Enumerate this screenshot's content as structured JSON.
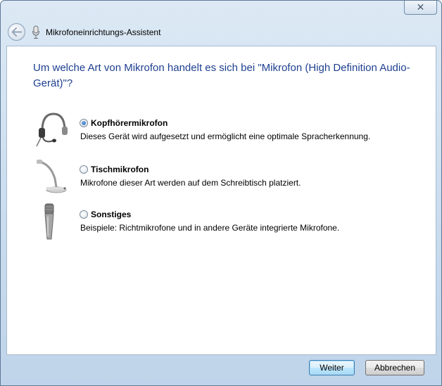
{
  "window": {
    "title": "Mikrofoneinrichtungs-Assistent",
    "close_glyph": "✕"
  },
  "main": {
    "question": "Um welche Art von Mikrofon handelt es sich bei \"Mikrofon (High Definition Audio-Gerät)\"?",
    "options": [
      {
        "icon": "headset-icon",
        "label": "Kopfhörermikrofon",
        "description": "Dieses Gerät wird aufgesetzt und ermöglicht eine optimale Spracherkennung.",
        "checked": true
      },
      {
        "icon": "desk-microphone-icon",
        "label": "Tischmikrofon",
        "description": "Mikrofone dieser Art werden auf dem Schreibtisch platziert.",
        "checked": false
      },
      {
        "icon": "handheld-microphone-icon",
        "label": "Sonstiges",
        "description": "Beispiele: Richtmikrofone und in andere Geräte integrierte Mikrofone.",
        "checked": false
      }
    ]
  },
  "footer": {
    "next_label": "Weiter",
    "cancel_label": "Abbrechen"
  },
  "colors": {
    "heading": "#1e3f8f",
    "chrome": "#c9dcee"
  }
}
